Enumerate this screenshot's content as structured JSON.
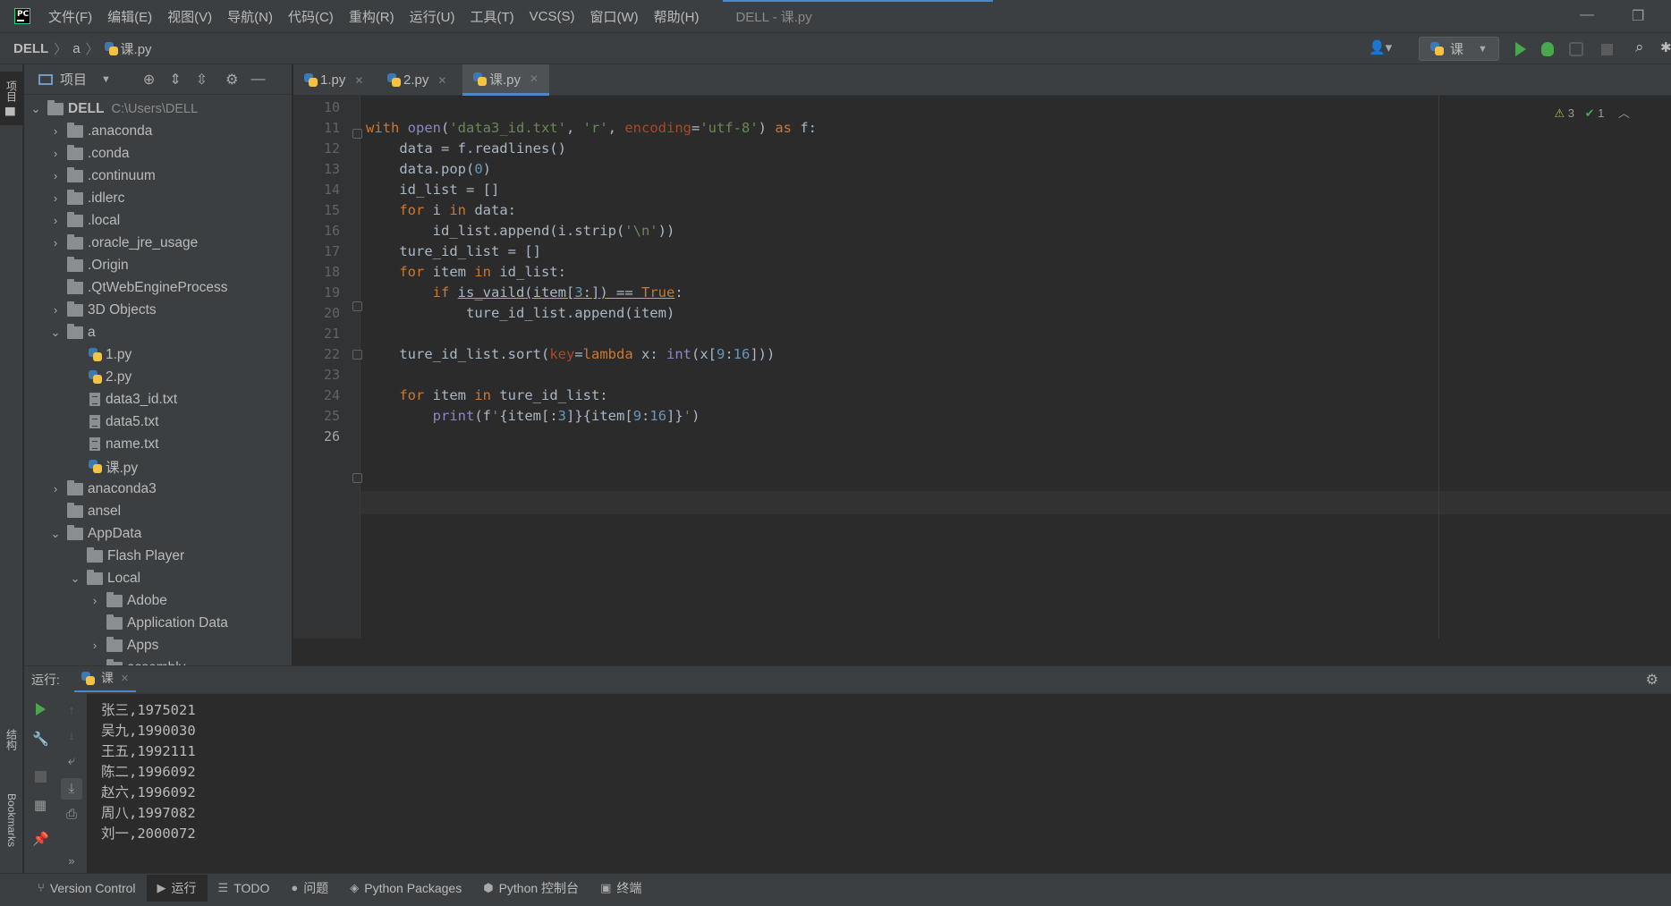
{
  "app": {
    "logo_text": "PC",
    "menu": [
      "文件(F)",
      "编辑(E)",
      "视图(V)",
      "导航(N)",
      "代码(C)",
      "重构(R)",
      "运行(U)",
      "工具(T)",
      "VCS(S)",
      "窗口(W)",
      "帮助(H)"
    ],
    "window_title": "DELL - 课.py",
    "minimize": "—",
    "restore": "❐"
  },
  "navbar": {
    "crumbs": [
      "DELL",
      "a",
      "课.py"
    ],
    "run_config": "课"
  },
  "stripe": {
    "project": "项目",
    "structure": "结构",
    "bookmarks": "Bookmarks"
  },
  "project": {
    "title": "项目",
    "tree": [
      {
        "label": "DELL",
        "hint": "C:\\Users\\DELL",
        "level": 0,
        "state": "open",
        "kind": "folder"
      },
      {
        "label": ".anaconda",
        "level": 1,
        "state": "closed",
        "kind": "folder"
      },
      {
        "label": ".conda",
        "level": 1,
        "state": "closed",
        "kind": "folder"
      },
      {
        "label": ".continuum",
        "level": 1,
        "state": "closed",
        "kind": "folder"
      },
      {
        "label": ".idlerc",
        "level": 1,
        "state": "closed",
        "kind": "folder"
      },
      {
        "label": ".local",
        "level": 1,
        "state": "closed",
        "kind": "folder"
      },
      {
        "label": ".oracle_jre_usage",
        "level": 1,
        "state": "closed",
        "kind": "folder"
      },
      {
        "label": ".Origin",
        "level": 1,
        "state": "none",
        "kind": "folder"
      },
      {
        "label": ".QtWebEngineProcess",
        "level": 1,
        "state": "none",
        "kind": "folder"
      },
      {
        "label": "3D Objects",
        "level": 1,
        "state": "closed",
        "kind": "folder"
      },
      {
        "label": "a",
        "level": 1,
        "state": "open",
        "kind": "folder"
      },
      {
        "label": "1.py",
        "level": 2,
        "state": "none",
        "kind": "py"
      },
      {
        "label": "2.py",
        "level": 2,
        "state": "none",
        "kind": "py"
      },
      {
        "label": "data3_id.txt",
        "level": 2,
        "state": "none",
        "kind": "txt"
      },
      {
        "label": "data5.txt",
        "level": 2,
        "state": "none",
        "kind": "txt"
      },
      {
        "label": "name.txt",
        "level": 2,
        "state": "none",
        "kind": "txt"
      },
      {
        "label": "课.py",
        "level": 2,
        "state": "none",
        "kind": "py"
      },
      {
        "label": "anaconda3",
        "level": 1,
        "state": "closed",
        "kind": "folder"
      },
      {
        "label": "ansel",
        "level": 1,
        "state": "none",
        "kind": "folder"
      },
      {
        "label": "AppData",
        "level": 1,
        "state": "open",
        "kind": "folder"
      },
      {
        "label": "Flash Player",
        "level": 2,
        "state": "none",
        "kind": "folder"
      },
      {
        "label": "Local",
        "level": 2,
        "state": "open",
        "kind": "folder"
      },
      {
        "label": "Adobe",
        "level": 3,
        "state": "closed",
        "kind": "folder"
      },
      {
        "label": "Application Data",
        "level": 3,
        "state": "none",
        "kind": "folder"
      },
      {
        "label": "Apps",
        "level": 3,
        "state": "closed",
        "kind": "folder"
      },
      {
        "label": "assembly",
        "level": 3,
        "state": "closed",
        "kind": "folder"
      }
    ]
  },
  "editor": {
    "tabs": [
      {
        "label": "1.py",
        "active": false
      },
      {
        "label": "2.py",
        "active": false
      },
      {
        "label": "课.py",
        "active": true
      }
    ],
    "inspections": {
      "warnings": "3",
      "weak": "1"
    },
    "line_numbers": [
      "10",
      "11",
      "12",
      "13",
      "14",
      "15",
      "16",
      "17",
      "18",
      "19",
      "20",
      "21",
      "22",
      "23",
      "24",
      "25",
      "26"
    ],
    "code": [
      [],
      [
        [
          "kw",
          "with "
        ],
        [
          "bi",
          "open"
        ],
        [
          "p",
          "("
        ],
        [
          "str",
          "'data3_id.txt'"
        ],
        [
          "p",
          ", "
        ],
        [
          "str",
          "'r'"
        ],
        [
          "p",
          ", "
        ],
        [
          "kwarg",
          "encoding"
        ],
        [
          "p",
          "="
        ],
        [
          "str",
          "'utf-8'"
        ],
        [
          "p",
          ") "
        ],
        [
          "kw",
          "as "
        ],
        [
          "p",
          "f:"
        ]
      ],
      [
        [
          "p",
          "    data = f.readlines()"
        ]
      ],
      [
        [
          "p",
          "    data.pop("
        ],
        [
          "num",
          "0"
        ],
        [
          "p",
          ")"
        ]
      ],
      [
        [
          "p",
          "    id_list = []"
        ]
      ],
      [
        [
          "kw",
          "    for "
        ],
        [
          "p",
          "i "
        ],
        [
          "kw",
          "in "
        ],
        [
          "p",
          "data:"
        ]
      ],
      [
        [
          "p",
          "        id_list.append(i.strip("
        ],
        [
          "str",
          "'\\n'"
        ],
        [
          "p",
          "))"
        ]
      ],
      [
        [
          "p",
          "    ture_id_list = []"
        ]
      ],
      [
        [
          "kw",
          "    for "
        ],
        [
          "p",
          "item "
        ],
        [
          "kw",
          "in "
        ],
        [
          "p",
          "id_list:"
        ]
      ],
      [
        [
          "kw",
          "        if "
        ],
        [
          "u",
          "is_vaild(item["
        ],
        [
          "un",
          "3"
        ],
        [
          "u",
          ":]) == "
        ],
        [
          "uk",
          "True"
        ],
        [
          "p",
          ":"
        ]
      ],
      [
        [
          "p",
          "            ture_id_list.append(item)"
        ]
      ],
      [],
      [
        [
          "p",
          "    ture_id_list.sort("
        ],
        [
          "kwarg",
          "key"
        ],
        [
          "p",
          "="
        ],
        [
          "kw",
          "lambda "
        ],
        [
          "p",
          "x: "
        ],
        [
          "bi",
          "int"
        ],
        [
          "p",
          "(x["
        ],
        [
          "num",
          "9"
        ],
        [
          "p",
          ":"
        ],
        [
          "num",
          "16"
        ],
        [
          "p",
          "]))"
        ]
      ],
      [],
      [
        [
          "kw",
          "    for "
        ],
        [
          "p",
          "item "
        ],
        [
          "kw",
          "in "
        ],
        [
          "p",
          "ture_id_list:"
        ]
      ],
      [
        [
          "p",
          "        "
        ],
        [
          "bi",
          "print"
        ],
        [
          "p",
          "(f"
        ],
        [
          "str",
          "'"
        ],
        [
          "p",
          "{item[:"
        ],
        [
          "num",
          "3"
        ],
        [
          "p",
          "]}"
        ],
        [
          "p",
          "{item["
        ],
        [
          "num",
          "9"
        ],
        [
          "p",
          ":"
        ],
        [
          "num",
          "16"
        ],
        [
          "p",
          "]}"
        ],
        [
          "str",
          "'"
        ],
        [
          "p",
          ")"
        ]
      ],
      []
    ]
  },
  "run": {
    "label": "运行:",
    "tab": "课",
    "output": [
      "张三,1975021",
      "吴九,1990030",
      "王五,1992111",
      "陈二,1996092",
      "赵六,1996092",
      "周八,1997082",
      "刘一,2000072"
    ]
  },
  "toolwindows": [
    {
      "label": "Version Control",
      "glyph": "⑂",
      "active": false
    },
    {
      "label": "运行",
      "glyph": "▶",
      "active": true
    },
    {
      "label": "TODO",
      "glyph": "☰",
      "active": false
    },
    {
      "label": "问题",
      "glyph": "●",
      "active": false
    },
    {
      "label": "Python Packages",
      "glyph": "◈",
      "active": false
    },
    {
      "label": "Python 控制台",
      "glyph": "⬢",
      "active": false
    },
    {
      "label": "终端",
      "glyph": "▣",
      "active": false
    }
  ],
  "colors": {
    "accent": "#4a88c7",
    "run_green": "#49a84d",
    "keyword": "#cc7832",
    "string": "#6a8759",
    "number": "#6897bb"
  }
}
